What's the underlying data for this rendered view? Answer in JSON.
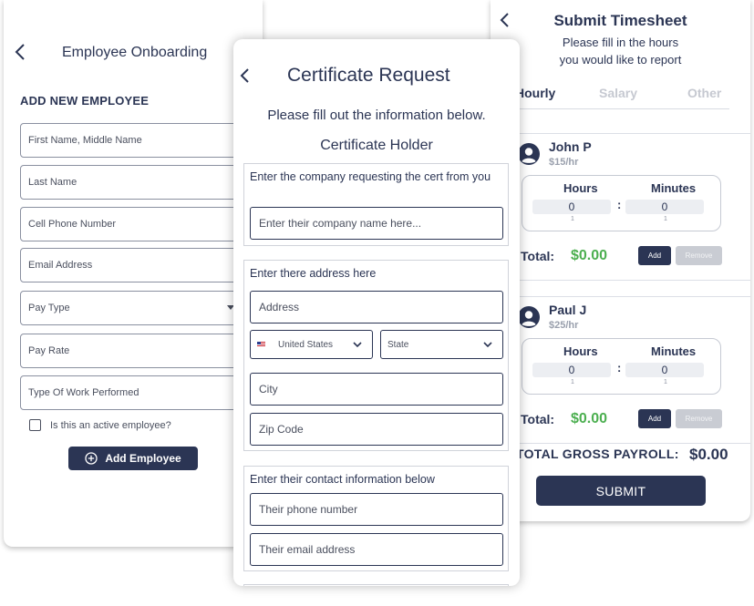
{
  "onboarding": {
    "title": "Employee Onboarding",
    "section_title": "ADD NEW EMPLOYEE",
    "fields": {
      "first_name": "First Name, Middle Name",
      "last_name": "Last Name",
      "cell_phone": "Cell Phone Number",
      "email": "Email Address",
      "pay_type": "Pay Type",
      "pay_rate": "Pay Rate",
      "work_type": "Type Of Work Performed"
    },
    "active_checkbox_label": "Is this an active employee?",
    "active_checked": false,
    "add_button_label": "Add Employee"
  },
  "certificate": {
    "title": "Certificate Request",
    "subtitle": "Please fill out the information below.",
    "holder_heading": "Certificate Holder",
    "company_group": {
      "label": "Enter the company requesting the cert from you",
      "company_placeholder": "Enter their company name here..."
    },
    "address_group": {
      "label": "Enter there address here",
      "address_placeholder": "Address",
      "country_value": "United States",
      "state_value": "State",
      "city_placeholder": "City",
      "zip_placeholder": "Zip Code"
    },
    "contact_group": {
      "label": "Enter their contact information below",
      "phone_placeholder": "Their phone number",
      "email_placeholder": "Their email address"
    }
  },
  "timesheet": {
    "title": "Submit Timesheet",
    "subtitle_line1": "Please fill in the hours",
    "subtitle_line2": "you would like to report",
    "tabs": [
      "Hourly",
      "Salary",
      "Other"
    ],
    "active_tab": "Hourly",
    "hours_label": "Hours",
    "minutes_label": "Minutes",
    "total_label": "Total:",
    "add_label": "Add",
    "remove_label": "Remove",
    "employees": [
      {
        "name": "John P",
        "rate": "$15/hr",
        "hours": "0",
        "minutes": "0",
        "hours_hint": "1",
        "minutes_hint": "1",
        "total": "$0.00"
      },
      {
        "name": "Paul J",
        "rate": "$25/hr",
        "hours": "0",
        "minutes": "0",
        "hours_hint": "1",
        "minutes_hint": "1",
        "total": "$0.00"
      }
    ],
    "gross_label": "TOTAL GROSS PAYROLL:",
    "gross_value": "$0.00",
    "submit_label": "SUBMIT"
  },
  "colors": {
    "primary": "#2b3554",
    "total_green": "#4caf50",
    "disabled": "#c9ccd3"
  }
}
